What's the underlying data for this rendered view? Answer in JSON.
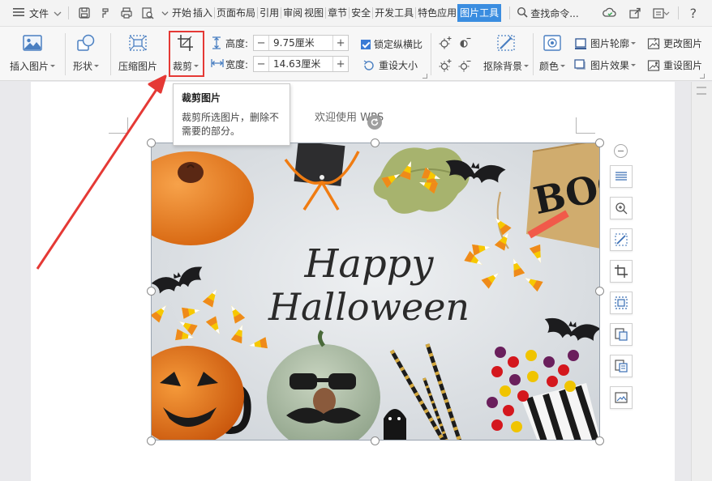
{
  "menubar": {
    "file_label": "文件",
    "start_label": "开始",
    "tabs": [
      "插入",
      "页面布局",
      "引用",
      "审阅",
      "视图",
      "章节",
      "安全",
      "开发工具",
      "特色应用",
      "图片工具"
    ],
    "active_tab": "图片工具",
    "search_label": "查找命令...",
    "help_label": "?"
  },
  "ribbon": {
    "insert_picture": "插入图片",
    "shape": "形状",
    "compress_picture": "压缩图片",
    "crop": "裁剪",
    "height_label": "高度:",
    "height_value": "9.75厘米",
    "width_label": "宽度:",
    "width_value": "14.63厘米",
    "lock_ratio": "锁定纵横比",
    "reset_size": "重设大小",
    "remove_background": "抠除背景",
    "color": "颜色",
    "picture_outline": "图片轮廓",
    "picture_effects": "图片效果",
    "change_picture": "更改图片",
    "reset_picture": "重设图片"
  },
  "tooltip": {
    "title": "裁剪图片",
    "body": "裁剪所选图片，删除不需要的部分。"
  },
  "document": {
    "header_text": "欢迎使用 WPS"
  },
  "picture": {
    "text_line1": "Happy",
    "text_line2": "Halloween"
  },
  "colors": {
    "accent": "#3a8de0",
    "highlight_red": "#e53935",
    "pumpkin_orange": "#f08a2c"
  }
}
